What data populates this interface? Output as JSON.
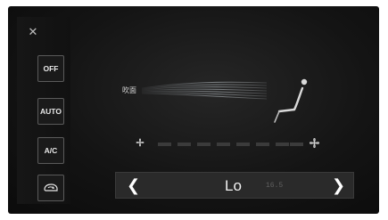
{
  "window": {
    "close_icon": "close-icon",
    "close_glyph": "✕"
  },
  "sidebar": {
    "off_label": "OFF",
    "auto_label": "AUTO",
    "ac_label": "A/C",
    "recirc_icon": "recirculation-icon"
  },
  "airflow": {
    "mode_label": "吹面",
    "airflow_icon": "airflow-lines-icon",
    "seat_icon": "seat-icon"
  },
  "fan": {
    "min_icon": "fan-small-icon",
    "max_icon": "fan-large-icon",
    "segments_total": 8,
    "segments_active": 0
  },
  "temperature": {
    "left_arrow": "❮",
    "right_arrow": "❯",
    "value": "Lo",
    "sub_value": "16.5"
  },
  "colors": {
    "background": "#141414",
    "text": "#f2f2f2",
    "segment_inactive": "#3b3b3b",
    "button_border": "#5a5a5a"
  }
}
